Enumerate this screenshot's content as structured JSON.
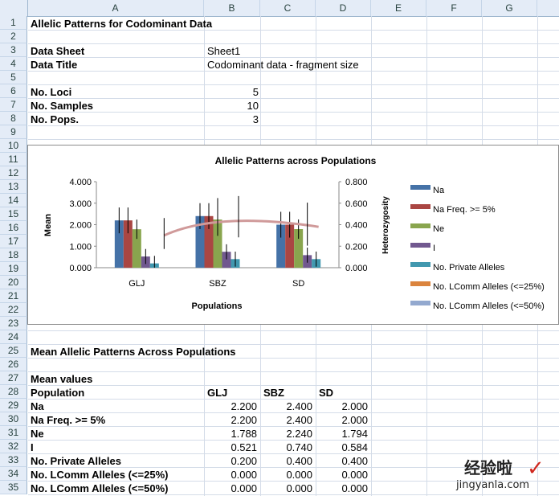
{
  "columns": [
    "A",
    "B",
    "C",
    "D",
    "E",
    "F",
    "G"
  ],
  "rows": [
    "1",
    "2",
    "3",
    "4",
    "5",
    "6",
    "7",
    "8",
    "9",
    "10",
    "11",
    "12",
    "13",
    "14",
    "15",
    "16",
    "17",
    "18",
    "19",
    "20",
    "21",
    "22",
    "23",
    "24",
    "25",
    "26",
    "27",
    "28",
    "29",
    "30",
    "31",
    "32",
    "33",
    "34",
    "35"
  ],
  "sheet": {
    "title": "Allelic Patterns for Codominant Data",
    "data_sheet_label": "Data Sheet",
    "data_sheet_value": "Sheet1",
    "data_title_label": "Data Title",
    "data_title_value": "Codominant data - fragment size",
    "loci_label": "No. Loci",
    "loci_value": "5",
    "samples_label": "No. Samples",
    "samples_value": "10",
    "pops_label": "No. Pops.",
    "pops_value": "3",
    "mean_title": "Mean Allelic Patterns Across Populations",
    "mean_values_label": "Mean values",
    "table_header": [
      "Population",
      "GLJ",
      "SBZ",
      "SD"
    ],
    "table_rows": [
      {
        "label": "Na",
        "values": [
          "2.200",
          "2.400",
          "2.000"
        ]
      },
      {
        "label": "Na Freq. >= 5%",
        "values": [
          "2.200",
          "2.400",
          "2.000"
        ]
      },
      {
        "label": "Ne",
        "values": [
          "1.788",
          "2.240",
          "1.794"
        ]
      },
      {
        "label": "I",
        "values": [
          "0.521",
          "0.740",
          "0.584"
        ]
      },
      {
        "label": "No. Private Alleles",
        "values": [
          "0.200",
          "0.400",
          "0.400"
        ]
      },
      {
        "label": "No. LComm Alleles (<=25%)",
        "values": [
          "0.000",
          "0.000",
          "0.000"
        ]
      },
      {
        "label": "No. LComm Alleles (<=50%)",
        "values": [
          "0.000",
          "0.000",
          "0.000"
        ]
      }
    ]
  },
  "chart_data": {
    "type": "bar",
    "title": "Allelic Patterns across Populations",
    "xlabel": "Populations",
    "ylabel": "Mean",
    "y2label": "Heterozygosity",
    "categories": [
      "GLJ",
      "SBZ",
      "SD"
    ],
    "ylim": [
      0,
      4
    ],
    "yticks": [
      "0.000",
      "1.000",
      "2.000",
      "3.000",
      "4.000"
    ],
    "y2lim": [
      0,
      0.8
    ],
    "y2ticks": [
      "0.000",
      "0.200",
      "0.400",
      "0.600",
      "0.800"
    ],
    "series": [
      {
        "name": "Na",
        "color": "#4572a7",
        "values": [
          2.2,
          2.4,
          2.0
        ]
      },
      {
        "name": "Na Freq. >= 5%",
        "color": "#aa4643",
        "values": [
          2.2,
          2.4,
          2.0
        ]
      },
      {
        "name": "Ne",
        "color": "#89a54e",
        "values": [
          1.788,
          2.24,
          1.794
        ]
      },
      {
        "name": "I",
        "color": "#71588f",
        "values": [
          0.521,
          0.74,
          0.584
        ]
      },
      {
        "name": "No. Private Alleles",
        "color": "#4198af",
        "values": [
          0.2,
          0.4,
          0.4
        ]
      },
      {
        "name": "No. LComm Alleles (<=25%)",
        "color": "#db843d",
        "values": [
          0,
          0,
          0
        ]
      },
      {
        "name": "No. LComm Alleles (<=50%)",
        "color": "#93a9cf",
        "values": [
          0,
          0,
          0
        ]
      }
    ],
    "heterozygosity_line": {
      "color": "#d09a9a",
      "points": [
        0.3,
        0.45,
        0.38
      ]
    },
    "legend_position": "right"
  },
  "watermark": {
    "line1": "经验啦",
    "line2": "jingyanla.com",
    "check": "✓"
  }
}
